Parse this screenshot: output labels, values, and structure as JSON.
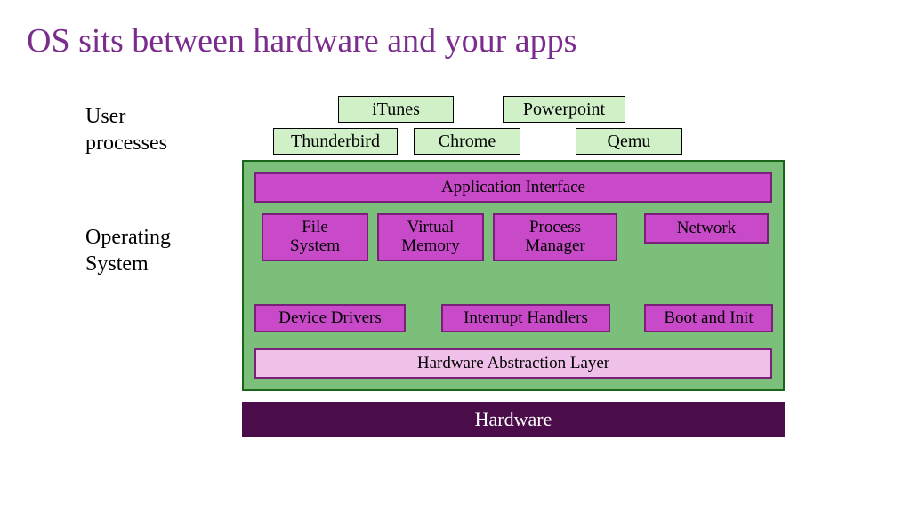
{
  "title": "OS sits between hardware and your apps",
  "labels": {
    "user": "User\nprocesses",
    "os": "Operating\nSystem"
  },
  "apps": {
    "itunes": "iTunes",
    "powerpoint": "Powerpoint",
    "thunderbird": "Thunderbird",
    "chrome": "Chrome",
    "qemu": "Qemu"
  },
  "os": {
    "app_interface": "Application Interface",
    "file_system": "File\nSystem",
    "virtual_memory": "Virtual\nMemory",
    "process_manager": "Process\nManager",
    "network": "Network",
    "device_drivers": "Device Drivers",
    "interrupt_handlers": "Interrupt Handlers",
    "boot_init": "Boot and Init",
    "hal": "Hardware Abstraction Layer"
  },
  "hardware": "Hardware"
}
